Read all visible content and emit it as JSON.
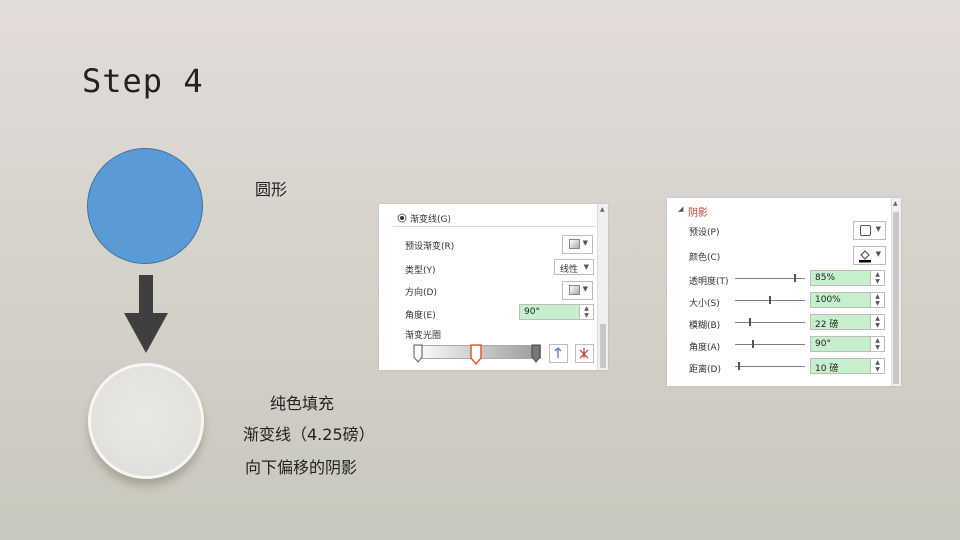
{
  "slide": {
    "title": "Step 4",
    "circle_label": "圆形",
    "desc_line1": "纯色填充",
    "desc_line2": "渐变线（4.25磅）",
    "desc_line3": "向下偏移的阴影"
  },
  "gradient_panel": {
    "radio_label": "渐变线(G)",
    "rows": [
      {
        "label": "预设渐变(R)",
        "control": "gradient-swatch"
      },
      {
        "label": "类型(Y)",
        "value": "线性"
      },
      {
        "label": "方向(D)",
        "control": "gradient-swatch"
      },
      {
        "label": "角度(E)",
        "value": "90°"
      }
    ],
    "stops_label": "渐变光圈"
  },
  "shadow_panel": {
    "section_title": "阴影",
    "section_title_color": "#c0392b",
    "preset_label": "预设(P)",
    "color_label": "颜色(C)",
    "sliders": [
      {
        "label": "透明度(T)",
        "value": "85%",
        "level": 0.85
      },
      {
        "label": "大小(S)",
        "value": "100%",
        "level": 0.5
      },
      {
        "label": "模糊(B)",
        "value": "22 磅",
        "level": 0.22
      },
      {
        "label": "角度(A)",
        "value": "90°",
        "level": 0.25
      },
      {
        "label": "距离(D)",
        "value": "10 磅",
        "level": 0.05
      }
    ]
  },
  "colors": {
    "blue_fill": "#5b9bd5",
    "arrow": "#3f3f3f",
    "field_highlight": "#c6efce",
    "selected_stop": "#e05a2a"
  }
}
